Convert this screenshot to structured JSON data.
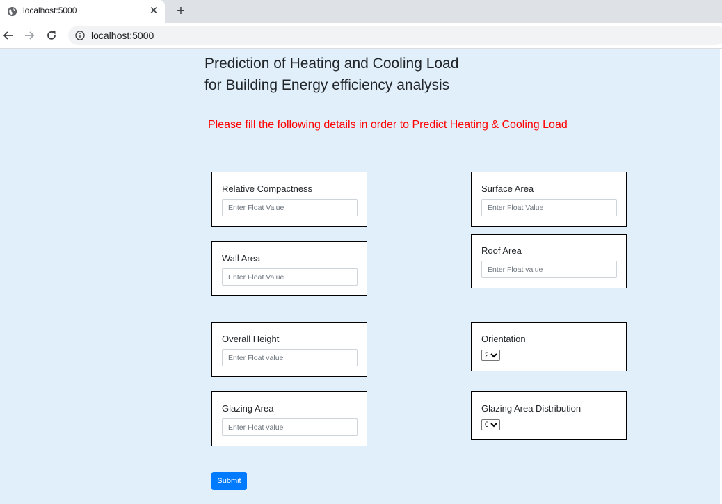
{
  "browser": {
    "tab_title": "localhost:5000",
    "url": "localhost:5000"
  },
  "page": {
    "title_line1": "Prediction of Heating and Cooling Load",
    "title_line2": "for Building Energy efficiency analysis",
    "instruction": "Please fill the following details in order to Predict Heating & Cooling Load",
    "instruction_color": "#ff0000",
    "submit_label": "Submit"
  },
  "fields": {
    "relative_compactness": {
      "label": "Relative Compactness",
      "placeholder": "Enter Float Value"
    },
    "surface_area": {
      "label": "Surface Area",
      "placeholder": "Enter Float Value"
    },
    "wall_area": {
      "label": "Wall Area",
      "placeholder": "Enter Float Value"
    },
    "roof_area": {
      "label": "Roof Area",
      "placeholder": "Enter Float value"
    },
    "overall_height": {
      "label": "Overall Height",
      "placeholder": "Enter Float value"
    },
    "orientation": {
      "label": "Orientation",
      "selected": "2"
    },
    "glazing_area": {
      "label": "Glazing Area",
      "placeholder": "Enter Float value"
    },
    "glazing_area_distribution": {
      "label": "Glazing Area Distribution",
      "selected": "0"
    }
  },
  "icons": {
    "favicon": "globe-icon",
    "close": "close-icon",
    "new_tab": "plus-icon",
    "back": "back-arrow-icon",
    "forward": "forward-arrow-icon",
    "reload": "reload-icon",
    "site_info": "info-icon"
  },
  "colors": {
    "page_background": "#e1effa",
    "submit_button": "#007bff"
  }
}
